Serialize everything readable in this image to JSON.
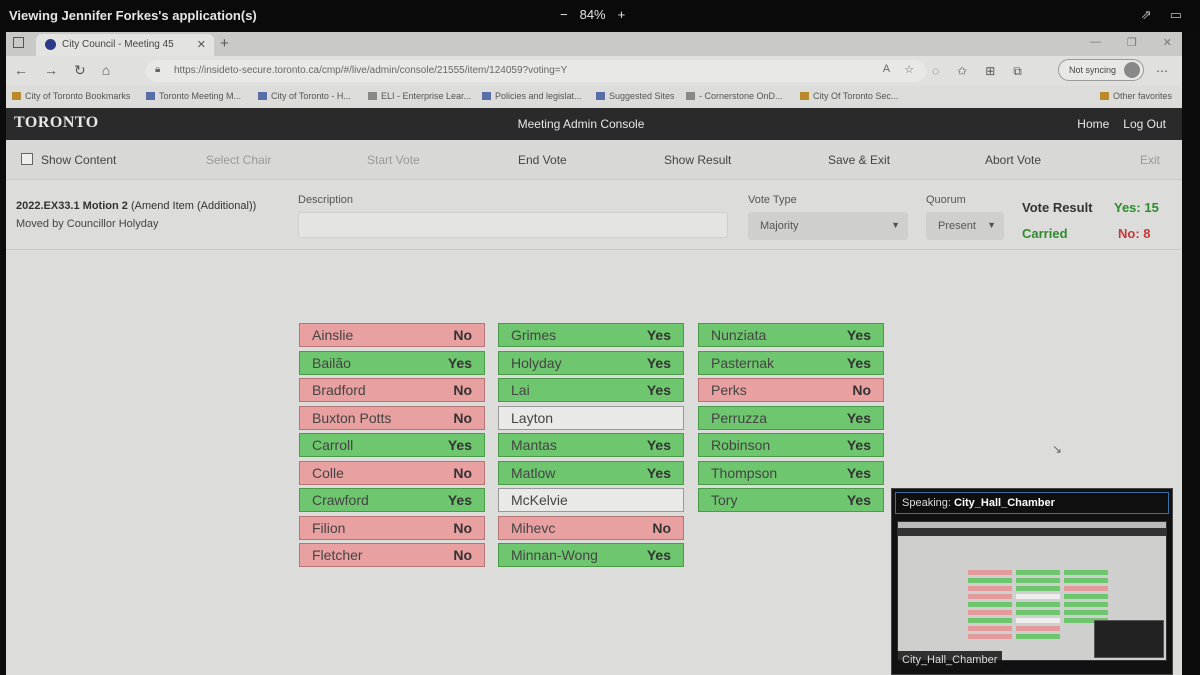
{
  "share": {
    "title": "Viewing Jennifer Forkes's application(s)",
    "zoom": "84%",
    "minus": "−",
    "plus": "+"
  },
  "browser": {
    "tab_title": "City Council - Meeting 45",
    "url": "https://insideto-secure.toronto.ca/cmp/#/live/admin/console/21555/item/124059?voting=Y",
    "sync_label": "Not syncing",
    "bookmarks": [
      "City of Toronto Bookmarks",
      "Toronto Meeting M...",
      "City of Toronto - H...",
      "ELI - Enterprise Lear...",
      "Policies and legislat...",
      "Suggested Sites",
      "- Cornerstone OnD...",
      "City Of Toronto Sec..."
    ],
    "other_favorites": "Other favorites"
  },
  "app": {
    "logo": "TORONTO",
    "title": "Meeting Admin Console",
    "home": "Home",
    "logout": "Log Out"
  },
  "toolbar": {
    "show_content": "Show Content",
    "select_chair": "Select Chair",
    "start_vote": "Start Vote",
    "end_vote": "End Vote",
    "show_result": "Show Result",
    "save_exit": "Save & Exit",
    "abort_vote": "Abort Vote",
    "exit": "Exit"
  },
  "motion": {
    "id": "2022.EX33.1 Motion 2",
    "type": "(Amend Item (Additional))",
    "moved_by": "Moved by Councillor Holyday",
    "description_label": "Description",
    "description_value": "",
    "vote_type_label": "Vote Type",
    "vote_type_value": "Majority",
    "quorum_label": "Quorum",
    "quorum_value": "Present",
    "vote_result_label": "Vote Result",
    "result_status": "Carried",
    "yes_count": "Yes: 15",
    "no_count": "No: 8"
  },
  "votes": {
    "col1": [
      {
        "name": "Ainslie",
        "vote": "No"
      },
      {
        "name": "Bailão",
        "vote": "Yes"
      },
      {
        "name": "Bradford",
        "vote": "No"
      },
      {
        "name": "Buxton Potts",
        "vote": "No"
      },
      {
        "name": "Carroll",
        "vote": "Yes"
      },
      {
        "name": "Colle",
        "vote": "No"
      },
      {
        "name": "Crawford",
        "vote": "Yes"
      },
      {
        "name": "Filion",
        "vote": "No"
      },
      {
        "name": "Fletcher",
        "vote": "No"
      }
    ],
    "col2": [
      {
        "name": "Grimes",
        "vote": "Yes"
      },
      {
        "name": "Holyday",
        "vote": "Yes"
      },
      {
        "name": "Lai",
        "vote": "Yes"
      },
      {
        "name": "Layton",
        "vote": ""
      },
      {
        "name": "Mantas",
        "vote": "Yes"
      },
      {
        "name": "Matlow",
        "vote": "Yes"
      },
      {
        "name": "McKelvie",
        "vote": ""
      },
      {
        "name": "Mihevc",
        "vote": "No"
      },
      {
        "name": "Minnan-Wong",
        "vote": "Yes"
      }
    ],
    "col3": [
      {
        "name": "Nunziata",
        "vote": "Yes"
      },
      {
        "name": "Pasternak",
        "vote": "Yes"
      },
      {
        "name": "Perks",
        "vote": "No"
      },
      {
        "name": "Perruzza",
        "vote": "Yes"
      },
      {
        "name": "Robinson",
        "vote": "Yes"
      },
      {
        "name": "Thompson",
        "vote": "Yes"
      },
      {
        "name": "Tory",
        "vote": "Yes"
      }
    ]
  },
  "speaker": {
    "label": "Speaking:",
    "name": "City_Hall_Chamber",
    "thumb_label": "City_Hall_Chamber"
  }
}
